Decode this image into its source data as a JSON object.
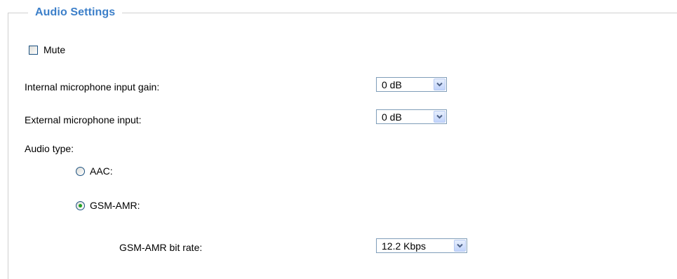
{
  "section": {
    "title": "Audio Settings"
  },
  "mute": {
    "label": "Mute",
    "checked": false
  },
  "internal_gain": {
    "label": "Internal microphone input gain:",
    "value": "0 dB"
  },
  "external_input": {
    "label": "External microphone input:",
    "value": "0 dB"
  },
  "audio_type": {
    "label": "Audio type:",
    "options": [
      {
        "label": "AAC:",
        "selected": false
      },
      {
        "label": "GSM-AMR:",
        "selected": true
      }
    ]
  },
  "gsm_amr_bitrate": {
    "label": "GSM-AMR bit rate:",
    "value": "12.2 Kbps"
  },
  "icons": {
    "dropdown": "chevron-down-icon"
  },
  "colors": {
    "legend": "#3c7fc9",
    "radio_selected": "#21a121",
    "select_border": "#7f9db9"
  }
}
